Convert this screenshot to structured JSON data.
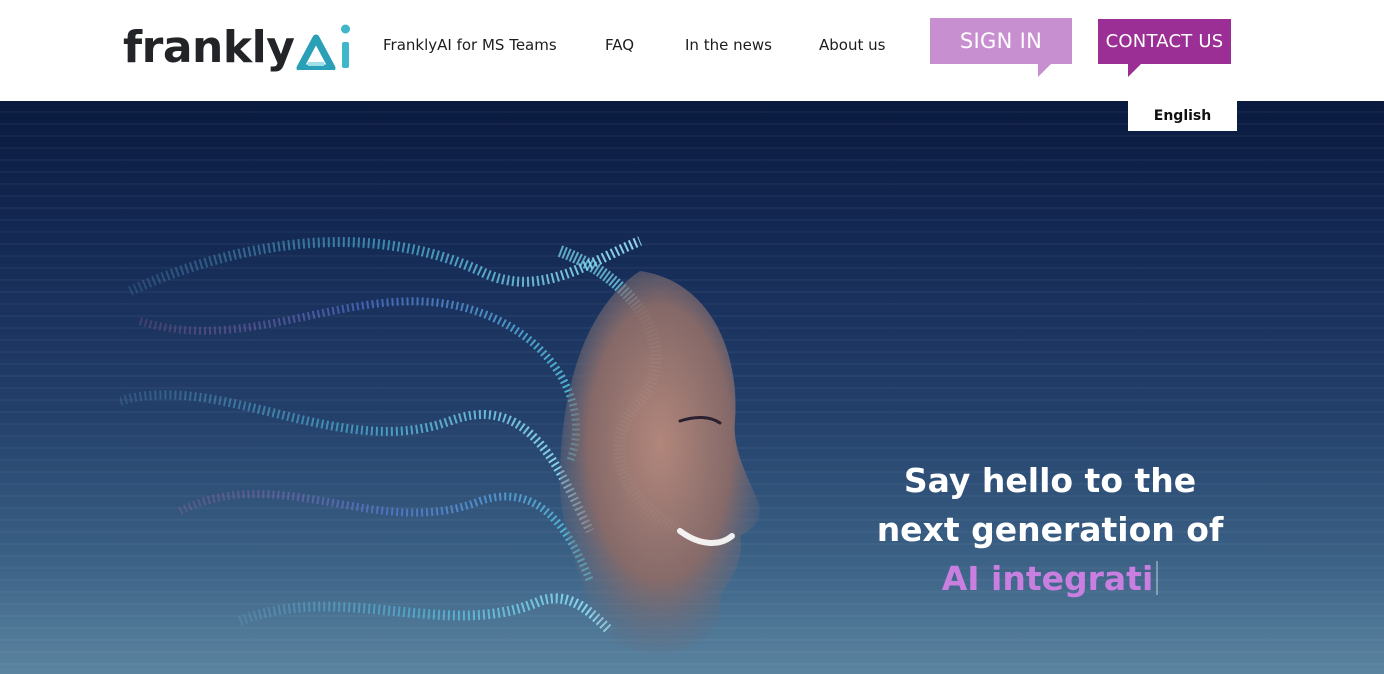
{
  "header": {
    "logo": {
      "text": "frankly",
      "mark_icon": "ai-logo-mark-icon",
      "accent_colors": [
        "#2bb3c9",
        "#6fd0dc"
      ]
    },
    "nav": [
      {
        "label": "FranklyAI for MS Teams"
      },
      {
        "label": "FAQ"
      },
      {
        "label": "In the news"
      },
      {
        "label": "About us"
      }
    ],
    "sign_in": {
      "label": "SIGN IN",
      "color": "#c88fd0"
    },
    "contact": {
      "label": "CONTACT US",
      "color": "#9b2f96"
    }
  },
  "language": {
    "selected": "English"
  },
  "hero": {
    "headline_line1": "Say hello to the",
    "headline_line2": "next generation of",
    "headline_accent": "AI integrati",
    "accent_color": "#c97fe0",
    "image_icon": "ai-face-particles-illustration"
  }
}
